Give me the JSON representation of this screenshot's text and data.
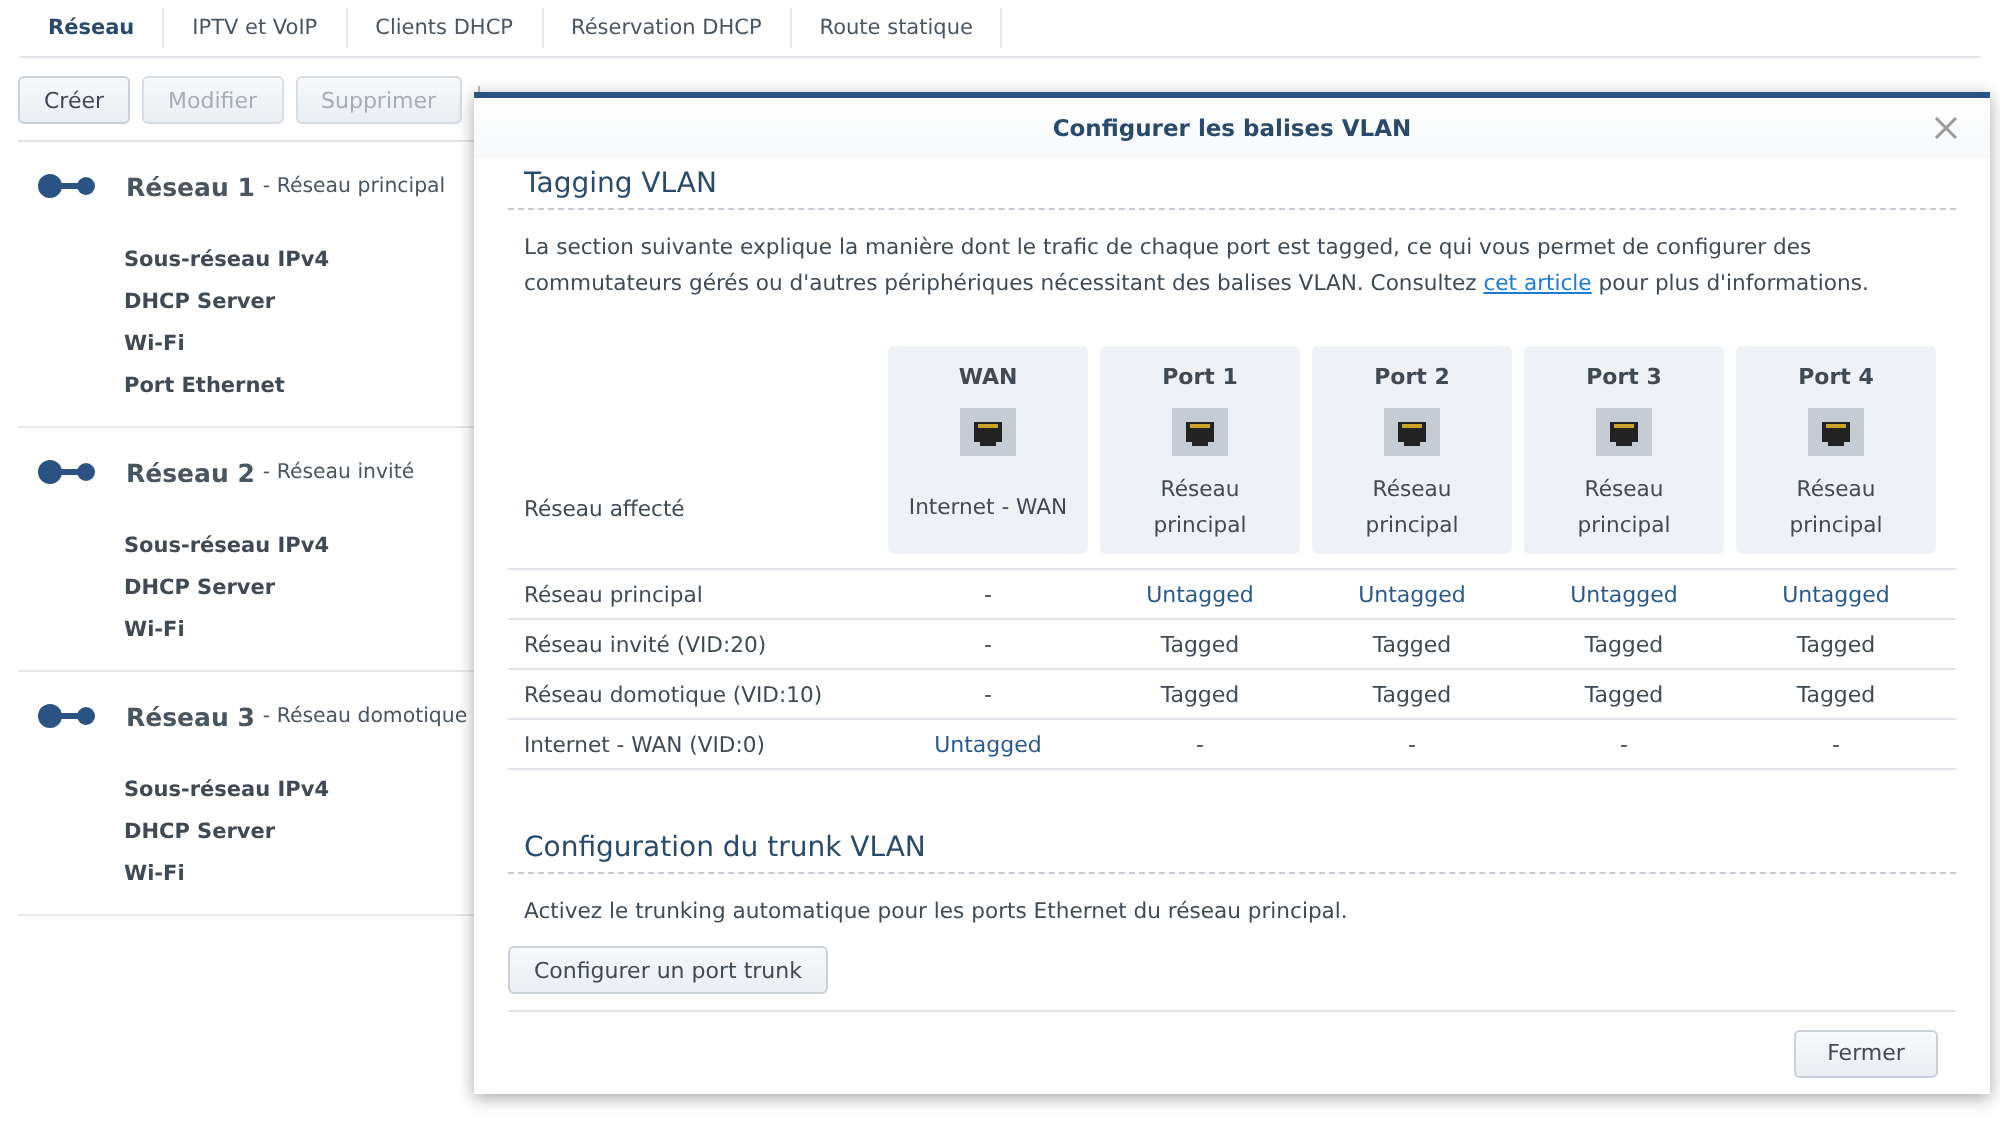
{
  "tabs": [
    {
      "label": "Réseau",
      "selected": true
    },
    {
      "label": "IPTV et VoIP",
      "selected": false
    },
    {
      "label": "Clients DHCP",
      "selected": false
    },
    {
      "label": "Réservation DHCP",
      "selected": false
    },
    {
      "label": "Route statique",
      "selected": false
    }
  ],
  "toolbar": [
    {
      "label": "Créer",
      "disabled": false
    },
    {
      "label": "Modifier",
      "disabled": true
    },
    {
      "label": "Supprimer",
      "disabled": true
    }
  ],
  "networks": [
    {
      "title": "Réseau 1",
      "subtitle": "- Réseau principal",
      "fields": [
        {
          "label": "Sous-réseau IPv4"
        },
        {
          "label": "DHCP Server"
        },
        {
          "label": "Wi-Fi"
        },
        {
          "label": "Port Ethernet"
        }
      ]
    },
    {
      "title": "Réseau 2",
      "subtitle": "- Réseau invité",
      "fields": [
        {
          "label": "Sous-réseau IPv4"
        },
        {
          "label": "DHCP Server"
        },
        {
          "label": "Wi-Fi"
        }
      ]
    },
    {
      "title": "Réseau 3",
      "subtitle": "- Réseau domotique",
      "fields": [
        {
          "label": "Sous-réseau IPv4"
        },
        {
          "label": "DHCP Server"
        },
        {
          "label": "Wi-Fi"
        }
      ]
    }
  ],
  "dialog": {
    "title": "Configurer les balises VLAN",
    "tagging": {
      "heading": "Tagging VLAN",
      "text_before": "La section suivante explique la manière dont le trafic de chaque port est tagged, ce qui vous permet de configurer des commutateurs gérés ou d'autres périphériques nécessitant des balises VLAN. Consultez ",
      "link": "cet article",
      "text_after": " pour plus d'informations.",
      "table": {
        "corner": "Réseau affecté",
        "ports": [
          {
            "name": "WAN",
            "network": "Internet - WAN"
          },
          {
            "name": "Port 1",
            "network": "Réseau principal"
          },
          {
            "name": "Port 2",
            "network": "Réseau principal"
          },
          {
            "name": "Port 3",
            "network": "Réseau principal"
          },
          {
            "name": "Port 4",
            "network": "Réseau principal"
          }
        ],
        "rows": [
          {
            "name": "Réseau principal",
            "cells": [
              {
                "text": "-",
                "kind": "none"
              },
              {
                "text": "Untagged",
                "kind": "untagged"
              },
              {
                "text": "Untagged",
                "kind": "untagged"
              },
              {
                "text": "Untagged",
                "kind": "untagged"
              },
              {
                "text": "Untagged",
                "kind": "untagged"
              }
            ]
          },
          {
            "name": "Réseau invité (VID:20)",
            "cells": [
              {
                "text": "-",
                "kind": "none"
              },
              {
                "text": "Tagged",
                "kind": "tagged"
              },
              {
                "text": "Tagged",
                "kind": "tagged"
              },
              {
                "text": "Tagged",
                "kind": "tagged"
              },
              {
                "text": "Tagged",
                "kind": "tagged"
              }
            ]
          },
          {
            "name": "Réseau domotique (VID:10)",
            "cells": [
              {
                "text": "-",
                "kind": "none"
              },
              {
                "text": "Tagged",
                "kind": "tagged"
              },
              {
                "text": "Tagged",
                "kind": "tagged"
              },
              {
                "text": "Tagged",
                "kind": "tagged"
              },
              {
                "text": "Tagged",
                "kind": "tagged"
              }
            ]
          },
          {
            "name": "Internet - WAN (VID:0)",
            "cells": [
              {
                "text": "Untagged",
                "kind": "untagged"
              },
              {
                "text": "-",
                "kind": "none"
              },
              {
                "text": "-",
                "kind": "none"
              },
              {
                "text": "-",
                "kind": "none"
              },
              {
                "text": "-",
                "kind": "none"
              }
            ]
          }
        ]
      }
    },
    "trunk": {
      "heading": "Configuration du trunk VLAN",
      "text": "Activez le trunking automatique pour les ports Ethernet du réseau principal.",
      "button": "Configurer un port trunk"
    },
    "close_button": "Fermer"
  }
}
